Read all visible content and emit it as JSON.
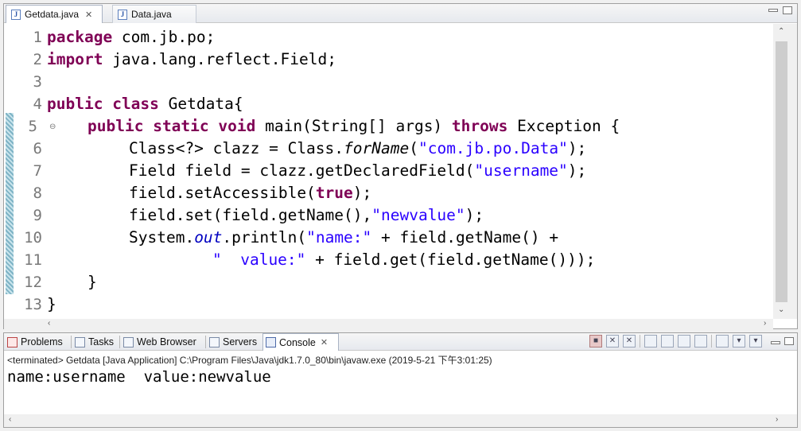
{
  "editor": {
    "tabs": [
      {
        "label": "Getdata.java",
        "icon": "java-file-icon",
        "active": true
      },
      {
        "label": "Data.java",
        "icon": "java-file-icon",
        "active": false
      }
    ],
    "line_numbers": [
      "1",
      "2",
      "3",
      "4",
      "5",
      "6",
      "7",
      "8",
      "9",
      "10",
      "11",
      "12",
      "13"
    ],
    "code": {
      "l1": {
        "kw": "package",
        "rest": " com.jb.po;"
      },
      "l2": {
        "kw": "import",
        "rest": " java.lang.reflect.Field;"
      },
      "l4": {
        "kw1": "public",
        "kw2": "class",
        "rest": " Getdata{"
      },
      "l5": {
        "kw1": "public",
        "kw2": "static",
        "kw3": "void",
        "a": " main(String[] args) ",
        "kw4": "throws",
        "b": " Exception {"
      },
      "l6": {
        "a": "Class<?> clazz = Class.",
        "it": "forName",
        "b": "(",
        "str": "\"com.jb.po.Data\"",
        "c": ");"
      },
      "l7": {
        "a": "Field field = clazz.getDeclaredField(",
        "str": "\"username\"",
        "b": ");"
      },
      "l8": {
        "a": "field.setAccessible(",
        "kw": "true",
        "b": ");"
      },
      "l9": {
        "a": "field.set(field.getName(),",
        "str": "\"newvalue\"",
        "b": ");"
      },
      "l10": {
        "a": "System.",
        "fld": "out",
        "b": ".println(",
        "str": "\"name:\"",
        "c": " + field.getName() +"
      },
      "l11": {
        "str": "\"  value:\"",
        "a": " + field.get(field.getName()));"
      },
      "l12": {
        "a": "}"
      },
      "l13": {
        "a": "}"
      }
    }
  },
  "console": {
    "tabs": [
      {
        "label": "Problems",
        "icon": "problems-icon"
      },
      {
        "label": "Tasks",
        "icon": "tasks-icon"
      },
      {
        "label": "Web Browser",
        "icon": "web-browser-icon"
      },
      {
        "label": "Servers",
        "icon": "servers-icon"
      },
      {
        "label": "Console",
        "icon": "console-icon",
        "active": true
      }
    ],
    "status": "<terminated> Getdata [Java Application] C:\\Program Files\\Java\\jdk1.7.0_80\\bin\\javaw.exe (2019-5-21 下午3:01:25)",
    "output": "name:username  value:newvalue"
  }
}
